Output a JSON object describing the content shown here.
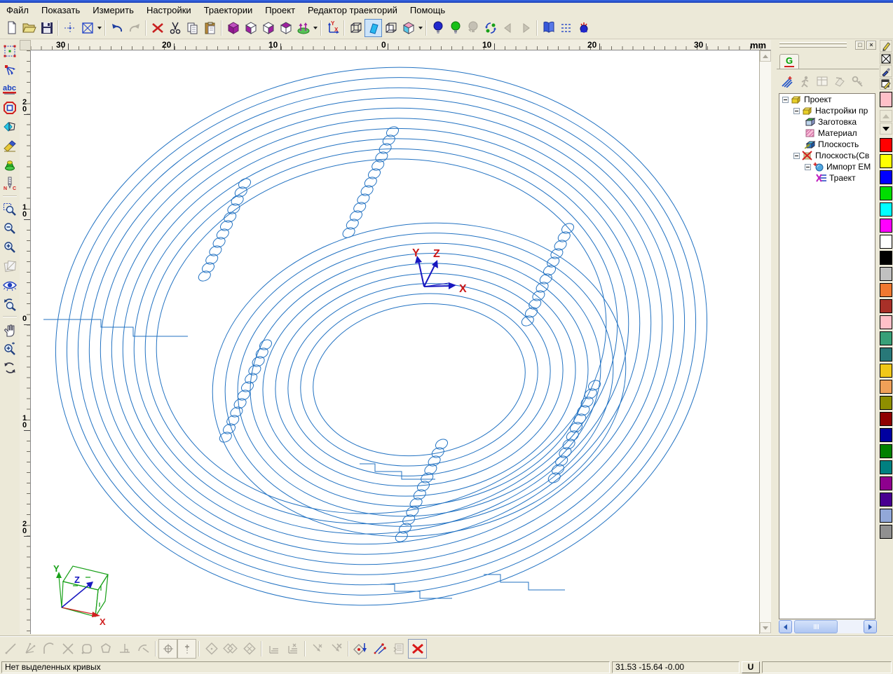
{
  "menu": {
    "items": [
      "Файл",
      "Показать",
      "Измерить",
      "Настройки",
      "Траектории",
      "Проект",
      "Редактор траекторий",
      "Помощь"
    ]
  },
  "toolbar": {
    "icons": [
      "new-document",
      "open-file",
      "save",
      "move-origin",
      "selection-box",
      "undo",
      "redo",
      "delete",
      "cut",
      "copy",
      "paste",
      "solid-cube-view",
      "wire-cube-face-front",
      "wire-cube-face-side",
      "wire-cube-face-top",
      "reverse-normals",
      "axes-xy",
      "wireframe-mode",
      "shaded-face-mode",
      "cube-mode",
      "colored-faces-mode",
      "light-blue",
      "light-green",
      "light-off",
      "swap-selection",
      "view-prev",
      "view-next",
      "project-pages",
      "dashed-list",
      "lamp-rays"
    ]
  },
  "left_toolbar": {
    "icons": [
      "select-box",
      "edit-nodes",
      "text-abc",
      "stop-shape",
      "fill-shape",
      "eraser",
      "funnel",
      "nc-code",
      "zoom-window",
      "zoom-out",
      "zoom-in",
      "sheets-disabled",
      "view-all-eye",
      "zoom-previous",
      "pan-hand",
      "zoom-dynamic",
      "rotate-view"
    ]
  },
  "icon_text": {
    "abc": "abc",
    "n": "N",
    "c": "C",
    "axes_y": "Y",
    "axes_x": "X"
  },
  "ruler": {
    "top": [
      "30",
      "20",
      "10",
      "0",
      "10",
      "20",
      "30"
    ],
    "unit": "mm",
    "left": [
      "20",
      "10",
      "0",
      "10",
      "20"
    ]
  },
  "viewport": {
    "curve_color": "#2272c2",
    "triad": {
      "x": "X",
      "y": "Y",
      "z": "Z"
    },
    "nav_cube": {
      "x": "X",
      "y": "Y",
      "z": "Z"
    }
  },
  "right_panel": {
    "maximize_glyph": "□",
    "close_glyph": "×",
    "tab": "G",
    "panel_toolbar": [
      "wand",
      "run-postprocessor",
      "table",
      "flip",
      "key"
    ],
    "tree": [
      {
        "label": "Проект",
        "level": 0,
        "expander": true,
        "icon": "project-bricks"
      },
      {
        "label": "Настройки пр",
        "level": 1,
        "expander": true,
        "icon": "project-bricks"
      },
      {
        "label": "Заготовка",
        "level": 2,
        "expander": false,
        "icon": "stock-box"
      },
      {
        "label": "Материал",
        "level": 2,
        "expander": false,
        "icon": "material-hatch"
      },
      {
        "label": "Плоскость",
        "level": 2,
        "expander": false,
        "icon": "plane-box"
      },
      {
        "label": "Плоскость(Св",
        "level": 1,
        "expander": true,
        "icon": "plane-crossed"
      },
      {
        "label": "Импорт EM",
        "level": 2,
        "expander": true,
        "icon": "import-shape"
      },
      {
        "label": "Траект",
        "level": 3,
        "expander": false,
        "icon": "toolpath-table"
      }
    ]
  },
  "palette": {
    "tools": [
      "pencil",
      "none-box",
      "dropper",
      "edit-colors"
    ],
    "current": "#ffc0c8",
    "swatches": [
      "#ff0000",
      "#ffff00",
      "#0000ff",
      "#00dd00",
      "#00ffff",
      "#ff00ff",
      "#ffffff",
      "#000000",
      "#c0c0c0",
      "#f07830",
      "#a83028",
      "#ffc0c8",
      "#38a078",
      "#287878",
      "#f0c818",
      "#f0a058",
      "#8e8e00",
      "#8e0000",
      "#0000a0",
      "#008000",
      "#008080",
      "#8e008e",
      "#480090",
      "#92a8d8",
      "#909090"
    ]
  },
  "bottom_toolbar": {
    "icons": [
      "line",
      "lines-from-point",
      "corner-arc",
      "intersect",
      "rounded-rect",
      "polygon",
      "perpendicular",
      "tangent-arc",
      "circle-cross",
      "point-marker",
      "diamond",
      "double-diamond",
      "diamond-x",
      "layers",
      "layers-corner",
      "arrow-x-small",
      "arrow-x-big",
      "insert-point",
      "check-geometry",
      "list-disabled",
      "delete-selected"
    ]
  },
  "status": {
    "message": "Нет выделенных кривых",
    "coords": "31.53 -15.64 -0.00",
    "units_button": "U"
  }
}
